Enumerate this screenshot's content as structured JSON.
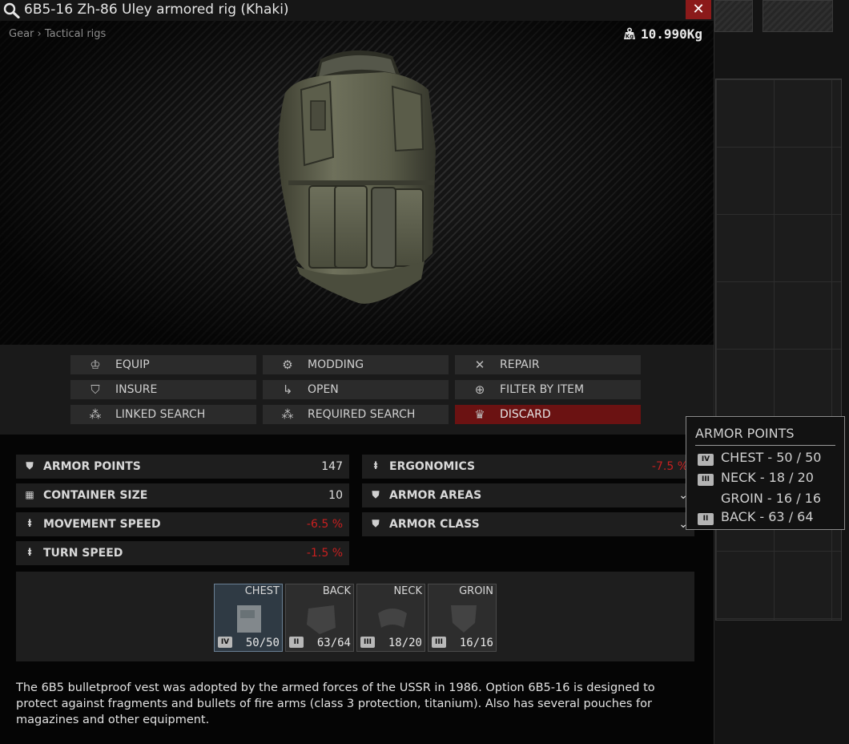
{
  "window": {
    "title": "6B5-16 Zh-86 Uley armored rig (Khaki)",
    "close_label": "✕",
    "breadcrumb": "Gear › Tactical rigs",
    "weight": "10.990Kg"
  },
  "actions": [
    {
      "label": "EQUIP",
      "icon": "equip-icon"
    },
    {
      "label": "MODDING",
      "icon": "modding-icon"
    },
    {
      "label": "REPAIR",
      "icon": "repair-icon"
    },
    {
      "label": "INSURE",
      "icon": "shield-icon"
    },
    {
      "label": "OPEN",
      "icon": "open-icon"
    },
    {
      "label": "FILTER BY ITEM",
      "icon": "filter-search-icon"
    },
    {
      "label": "LINKED SEARCH",
      "icon": "linked-search-icon"
    },
    {
      "label": "REQUIRED SEARCH",
      "icon": "required-search-icon"
    },
    {
      "label": "DISCARD",
      "icon": "discard-icon"
    }
  ],
  "stats": {
    "left": [
      {
        "label": "ARMOR POINTS",
        "value": "147",
        "icon": "armor-icon"
      },
      {
        "label": "CONTAINER SIZE",
        "value": "10",
        "icon": "grid-icon"
      },
      {
        "label": "MOVEMENT SPEED",
        "value": "-6.5 %",
        "icon": "speed-icon"
      },
      {
        "label": "TURN SPEED",
        "value": "-1.5 %",
        "icon": "speed-icon"
      }
    ],
    "right": [
      {
        "label": "ERGONOMICS",
        "value": "-7.5 %",
        "icon": "ergonomics-icon"
      },
      {
        "label": "ARMOR AREAS",
        "value": "⌄",
        "icon": "armor-icon"
      },
      {
        "label": "ARMOR CLASS",
        "value": "⌄",
        "icon": "armor-icon"
      }
    ]
  },
  "armor_slots": [
    {
      "name": "CHEST",
      "class": "IV",
      "points": "50/50"
    },
    {
      "name": "BACK",
      "class": "II",
      "points": "63/64"
    },
    {
      "name": "NECK",
      "class": "III",
      "points": "18/20"
    },
    {
      "name": "GROIN",
      "class": "III",
      "points": "16/16"
    }
  ],
  "description": "The 6B5 bulletproof vest was adopted by the armed forces of the USSR in 1986. Option 6B5-16 is designed to protect against fragments and bullets of fire arms (class 3 protection, titanium). Also has several pouches for magazines and other equipment.",
  "tooltip": {
    "title": "ARMOR POINTS",
    "rows": [
      {
        "class": "IV",
        "text": "CHEST - 50 / 50"
      },
      {
        "class": "III",
        "text": "NECK - 18 / 20"
      },
      {
        "class": "",
        "text": "GROIN - 16 / 16"
      },
      {
        "class": "II",
        "text": "BACK - 63 / 64"
      }
    ]
  },
  "colors": {
    "close": "#8b1a1a",
    "discard": "#6b1212",
    "negative": "#c82020",
    "selected_slot": "#2f3a44"
  }
}
